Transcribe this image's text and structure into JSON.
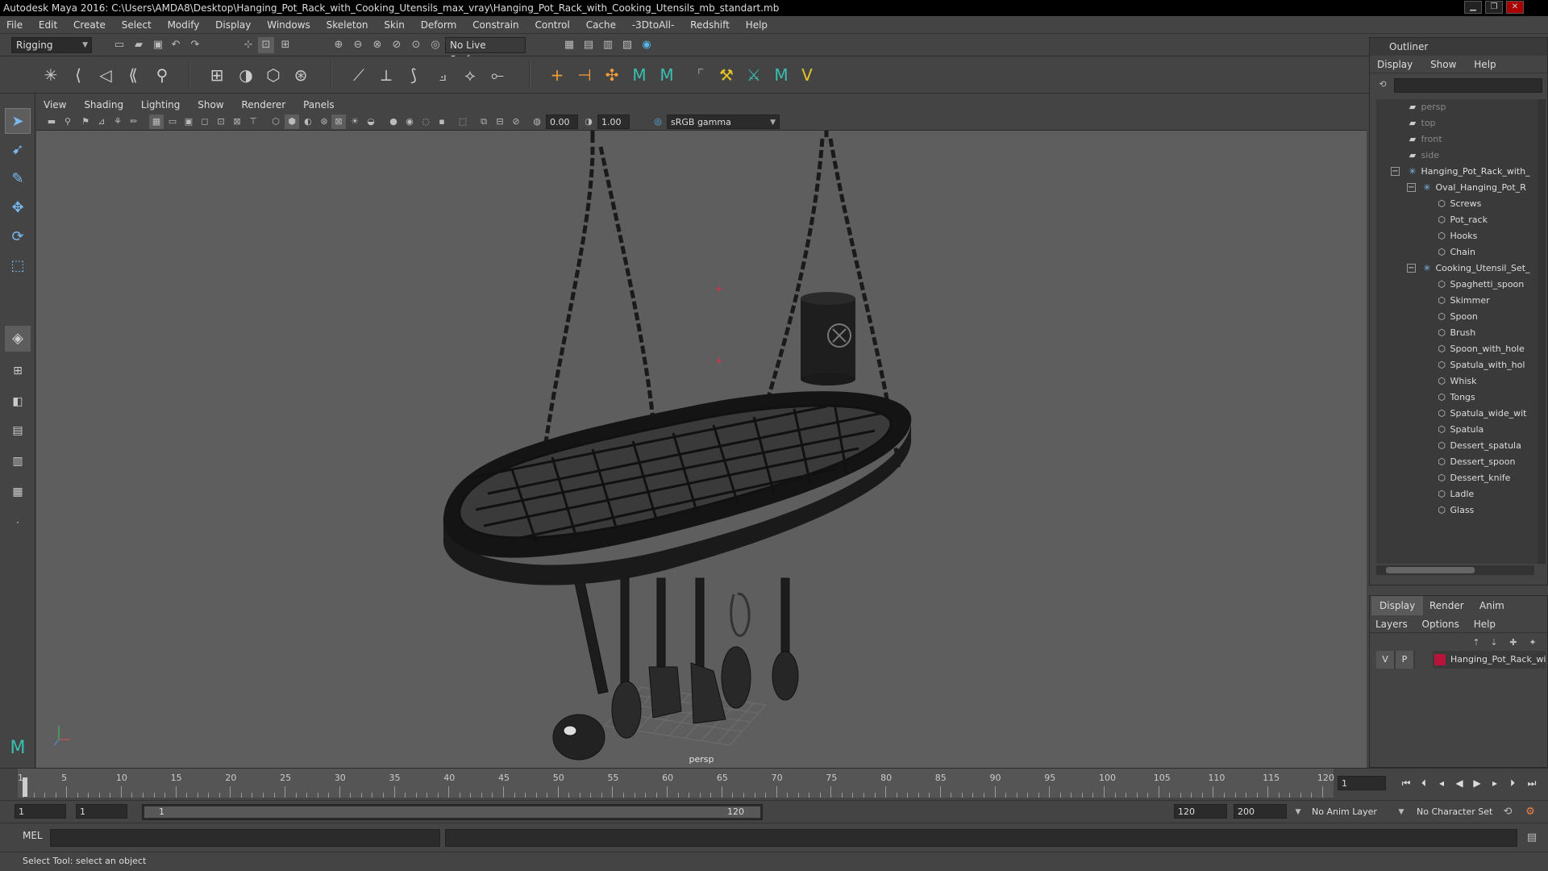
{
  "window": {
    "title": "Autodesk Maya 2016: C:\\Users\\AMDA8\\Desktop\\Hanging_Pot_Rack_with_Cooking_Utensils_max_vray\\Hanging_Pot_Rack_with_Cooking_Utensils_mb_standart.mb"
  },
  "menubar": {
    "items": [
      "File",
      "Edit",
      "Create",
      "Select",
      "Modify",
      "Display",
      "Windows",
      "Skeleton",
      "Skin",
      "Deform",
      "Constrain",
      "Control",
      "Cache",
      "-3DtoAll-",
      "Redshift",
      "Help"
    ]
  },
  "statusline": {
    "menuset": "Rigging",
    "live_surface": "No Live Surface"
  },
  "panel": {
    "menus": [
      "View",
      "Shading",
      "Lighting",
      "Show",
      "Renderer",
      "Panels"
    ],
    "exposure": "0.00",
    "gamma": "1.00",
    "colorspace": "sRGB gamma",
    "camera_label": "persp"
  },
  "outliner": {
    "title": "Outliner",
    "menus": [
      "Display",
      "Show",
      "Help"
    ],
    "items": [
      {
        "label": "persp",
        "kind": "camera"
      },
      {
        "label": "top",
        "kind": "camera"
      },
      {
        "label": "front",
        "kind": "camera"
      },
      {
        "label": "side",
        "kind": "camera"
      },
      {
        "label": "Hanging_Pot_Rack_with_",
        "kind": "group"
      },
      {
        "label": "Oval_Hanging_Pot_R",
        "kind": "group"
      },
      {
        "label": "Screws",
        "kind": "mesh"
      },
      {
        "label": "Pot_rack",
        "kind": "mesh"
      },
      {
        "label": "Hooks",
        "kind": "mesh"
      },
      {
        "label": "Chain",
        "kind": "mesh"
      },
      {
        "label": "Cooking_Utensil_Set_",
        "kind": "group"
      },
      {
        "label": "Spaghetti_spoon",
        "kind": "mesh"
      },
      {
        "label": "Skimmer",
        "kind": "mesh"
      },
      {
        "label": "Spoon",
        "kind": "mesh"
      },
      {
        "label": "Brush",
        "kind": "mesh"
      },
      {
        "label": "Spoon_with_hole",
        "kind": "mesh"
      },
      {
        "label": "Spatula_with_hol",
        "kind": "mesh"
      },
      {
        "label": "Whisk",
        "kind": "mesh"
      },
      {
        "label": "Tongs",
        "kind": "mesh"
      },
      {
        "label": "Spatula_wide_wit",
        "kind": "mesh"
      },
      {
        "label": "Spatula",
        "kind": "mesh"
      },
      {
        "label": "Dessert_spatula",
        "kind": "mesh"
      },
      {
        "label": "Dessert_spoon",
        "kind": "mesh"
      },
      {
        "label": "Dessert_knife",
        "kind": "mesh"
      },
      {
        "label": "Ladle",
        "kind": "mesh"
      },
      {
        "label": "Glass",
        "kind": "mesh"
      }
    ]
  },
  "layers": {
    "tabs": [
      "Display",
      "Render",
      "Anim"
    ],
    "menus": [
      "Layers",
      "Options",
      "Help"
    ],
    "layer": {
      "v": "V",
      "p": "P",
      "name": "Hanging_Pot_Rack_wi",
      "color": "#b8133a"
    }
  },
  "timeline": {
    "labels": [
      "1",
      "5",
      "10",
      "15",
      "20",
      "25",
      "30",
      "35",
      "40",
      "45",
      "50",
      "55",
      "60",
      "65",
      "70",
      "75",
      "80",
      "85",
      "90",
      "95",
      "100",
      "105",
      "110",
      "115",
      "120"
    ],
    "current_frame": "1"
  },
  "range": {
    "start": "1",
    "playback_start": "1",
    "slider_start": "1",
    "slider_end": "120",
    "playback_end": "120",
    "end": "200",
    "anim_layer": "No Anim Layer",
    "character_set": "No Character Set"
  },
  "cmdline": {
    "mode": "MEL"
  },
  "helpline": {
    "text": "Select Tool: select an object"
  },
  "colors": {
    "viewport_bg": "#5e5e5e",
    "ui_bg": "#444444",
    "active_tool": "#7ab8f0"
  }
}
